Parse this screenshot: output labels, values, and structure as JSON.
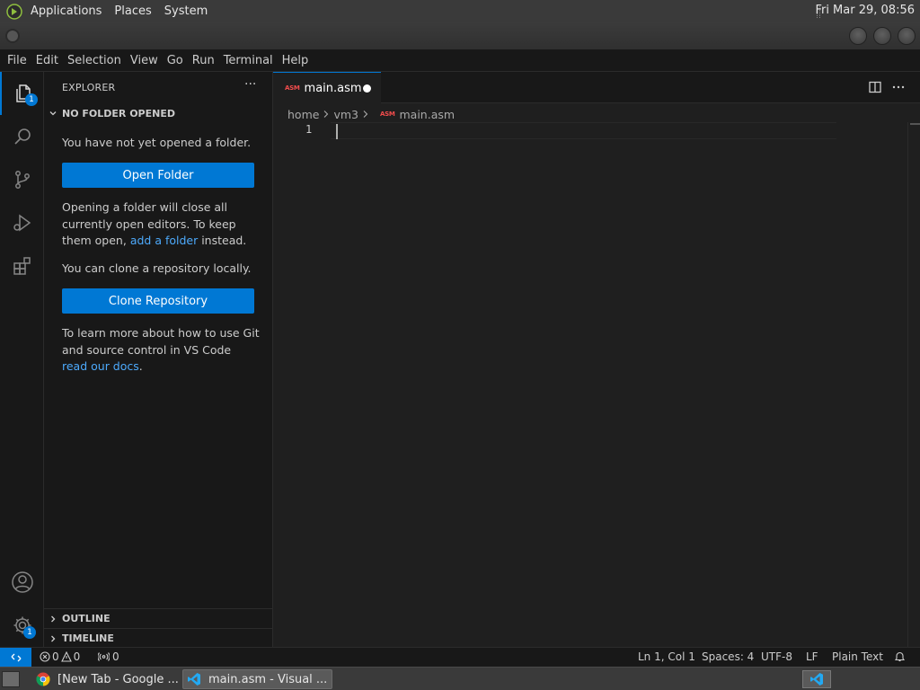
{
  "top_panel": {
    "menus": [
      "Applications",
      "Places",
      "System"
    ],
    "clock": "Fri Mar 29, 08:56"
  },
  "menubar": [
    "File",
    "Edit",
    "Selection",
    "View",
    "Go",
    "Run",
    "Terminal",
    "Help"
  ],
  "activity_bar": {
    "items": [
      {
        "name": "explorer",
        "icon": "files-icon",
        "badge": "1",
        "active": true
      },
      {
        "name": "search",
        "icon": "search-icon"
      },
      {
        "name": "source-control",
        "icon": "source-control-icon"
      },
      {
        "name": "run-debug",
        "icon": "run-debug-icon"
      },
      {
        "name": "extensions",
        "icon": "extensions-icon"
      }
    ],
    "bottom": [
      {
        "name": "accounts",
        "icon": "account-icon"
      },
      {
        "name": "manage",
        "icon": "gear-icon",
        "badge": "1"
      }
    ]
  },
  "sidebar": {
    "title": "EXPLORER",
    "more": "···",
    "section": "NO FOLDER OPENED",
    "msg_no_folder": "You have not yet opened a folder.",
    "open_folder_btn": "Open Folder",
    "msg_opening_pre": "Opening a folder will close all currently open editors. To keep them open, ",
    "msg_opening_link": "add a folder",
    "msg_opening_post": " instead.",
    "msg_clone": "You can clone a repository locally.",
    "clone_btn": "Clone Repository",
    "msg_learn_pre": "To learn more about how to use Git and source control in VS Code ",
    "msg_learn_link": "read our docs",
    "msg_learn_post": ".",
    "outline": "OUTLINE",
    "timeline": "TIMELINE"
  },
  "editor": {
    "tab": {
      "icon_text": "ASM",
      "label": "main.asm",
      "dirty": true
    },
    "breadcrumb": [
      "home",
      "vm3",
      "main.asm"
    ],
    "line_number": "1"
  },
  "status_bar": {
    "errors": "0",
    "warnings": "0",
    "ports": "0",
    "position": "Ln 1, Col 1",
    "spaces": "Spaces: 4",
    "encoding": "UTF-8",
    "eol": "LF",
    "language": "Plain Text"
  },
  "taskbar": {
    "tasks": [
      {
        "label": "[New Tab - Google ...",
        "active": false
      },
      {
        "label": "main.asm - Visual ...",
        "active": true
      }
    ]
  },
  "colors": {
    "accent": "#0078d4",
    "link": "#4daafc",
    "asm_icon": "#f14c4c"
  }
}
